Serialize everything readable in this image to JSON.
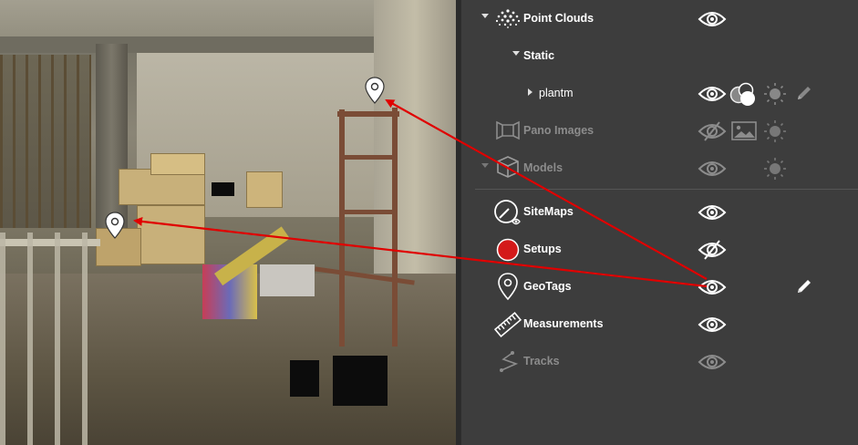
{
  "layers": {
    "point_clouds": {
      "label": "Point Clouds",
      "visible": true
    },
    "static": {
      "label": "Static"
    },
    "plantm": {
      "label": "plantm",
      "visible": true
    },
    "pano_images": {
      "label": "Pano Images",
      "visible": false,
      "enabled": false
    },
    "models": {
      "label": "Models",
      "enabled": false
    },
    "sitemaps": {
      "label": "SiteMaps",
      "visible": true
    },
    "setups": {
      "label": "Setups",
      "visible": false
    },
    "geotags": {
      "label": "GeoTags",
      "visible": true
    },
    "measurements": {
      "label": "Measurements",
      "visible": true
    },
    "tracks": {
      "label": "Tracks",
      "enabled": false
    }
  },
  "icons": {
    "visibility": "eye-icon",
    "visibility_off": "eye-slash-icon",
    "edit": "pencil-icon",
    "color_mode": "color-circles-icon",
    "brightness": "sun-icon",
    "image": "image-icon",
    "geotag": "map-pin-icon"
  },
  "colors": {
    "panel_bg": "#3d3d3d",
    "text": "#ffffff",
    "text_disabled": "#8c8c8c",
    "annotation_arrow": "#e00000",
    "setups_dot": "#d41a1a"
  }
}
